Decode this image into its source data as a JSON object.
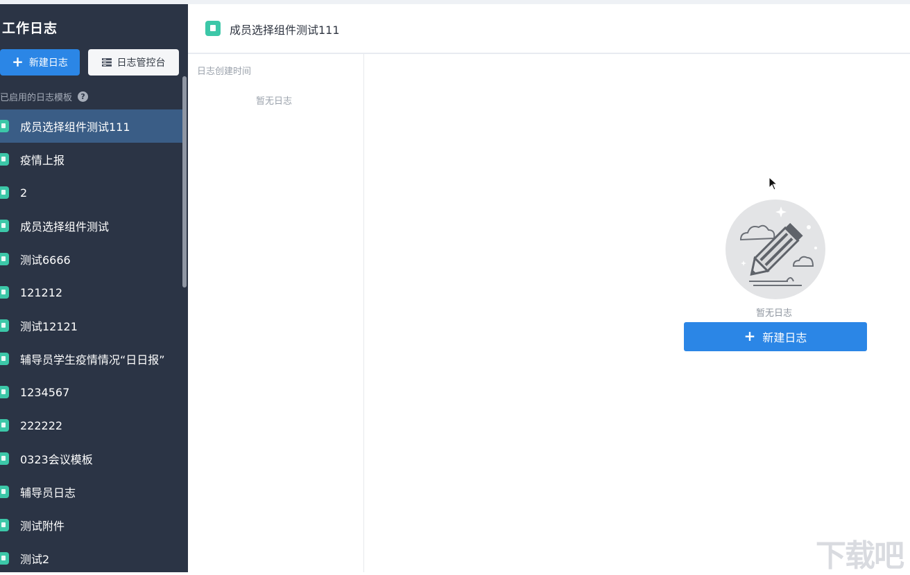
{
  "sidebar": {
    "title": "工作日志",
    "new_button_label": "新建日志",
    "console_button_label": "日志管控台",
    "section_label": "已启用的日志模板",
    "help_glyph": "?",
    "templates": [
      {
        "label": "成员选择组件测试111",
        "active": true
      },
      {
        "label": "疫情上报"
      },
      {
        "label": "2"
      },
      {
        "label": "成员选择组件测试"
      },
      {
        "label": "测试6666"
      },
      {
        "label": "121212"
      },
      {
        "label": "测试12121"
      },
      {
        "label": "辅导员学生疫情情况“日日报”"
      },
      {
        "label": "1234567"
      },
      {
        "label": "222222"
      },
      {
        "label": "0323会议模板"
      },
      {
        "label": "辅导员日志"
      },
      {
        "label": "测试附件"
      },
      {
        "label": "测试2"
      }
    ]
  },
  "header": {
    "title": "成员选择组件测试111"
  },
  "log_list": {
    "column_header": "日志创建时间",
    "empty_text": "暂无日志"
  },
  "main": {
    "empty_text": "暂无日志",
    "new_button_label": "新建日志"
  },
  "watermark": {
    "text": "下载吧"
  },
  "colors": {
    "sidebar_bg": "#2b3445",
    "active_item_bg": "#3a5d86",
    "primary_blue": "#2b86e6",
    "template_icon": "#3cc7a8"
  }
}
